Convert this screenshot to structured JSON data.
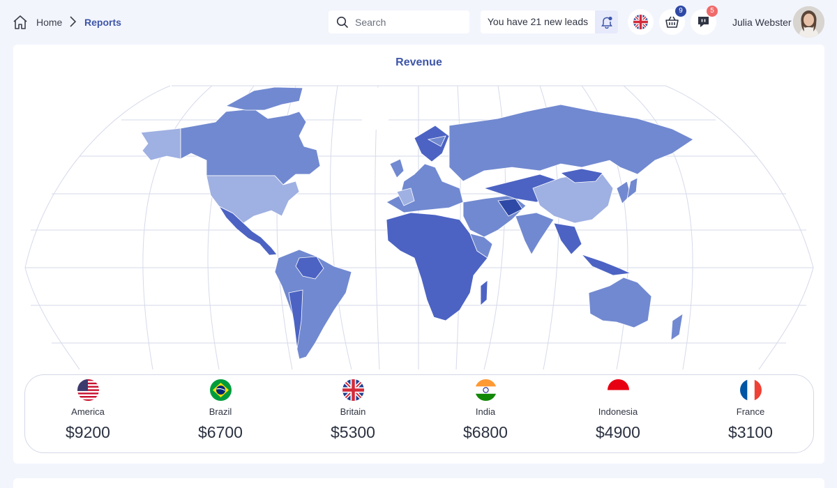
{
  "breadcrumb": {
    "home": "Home",
    "current": "Reports"
  },
  "search": {
    "placeholder": "Search"
  },
  "leads": {
    "text": "You have 21 new leads"
  },
  "header_icons": {
    "cart_count": "9",
    "messages_count": "5"
  },
  "user": {
    "name": "Julia Webster"
  },
  "card": {
    "title": "Revenue"
  },
  "countries": [
    {
      "name": "America",
      "value": "$9200",
      "flag": "usa-flag"
    },
    {
      "name": "Brazil",
      "value": "$6700",
      "flag": "brazil-flag"
    },
    {
      "name": "Britain",
      "value": "$5300",
      "flag": "uk-flag"
    },
    {
      "name": "India",
      "value": "$6800",
      "flag": "india-flag"
    },
    {
      "name": "Indonesia",
      "value": "$4900",
      "flag": "indonesia-flag"
    },
    {
      "name": "France",
      "value": "$3100",
      "flag": "france-flag"
    }
  ],
  "colors": {
    "accent": "#3d55a8",
    "map_dark": "#4c63c3",
    "map_mid": "#7189d0",
    "map_light": "#9fb0e2",
    "badge_blue": "#2f4aa6",
    "badge_red": "#f06a6a"
  }
}
